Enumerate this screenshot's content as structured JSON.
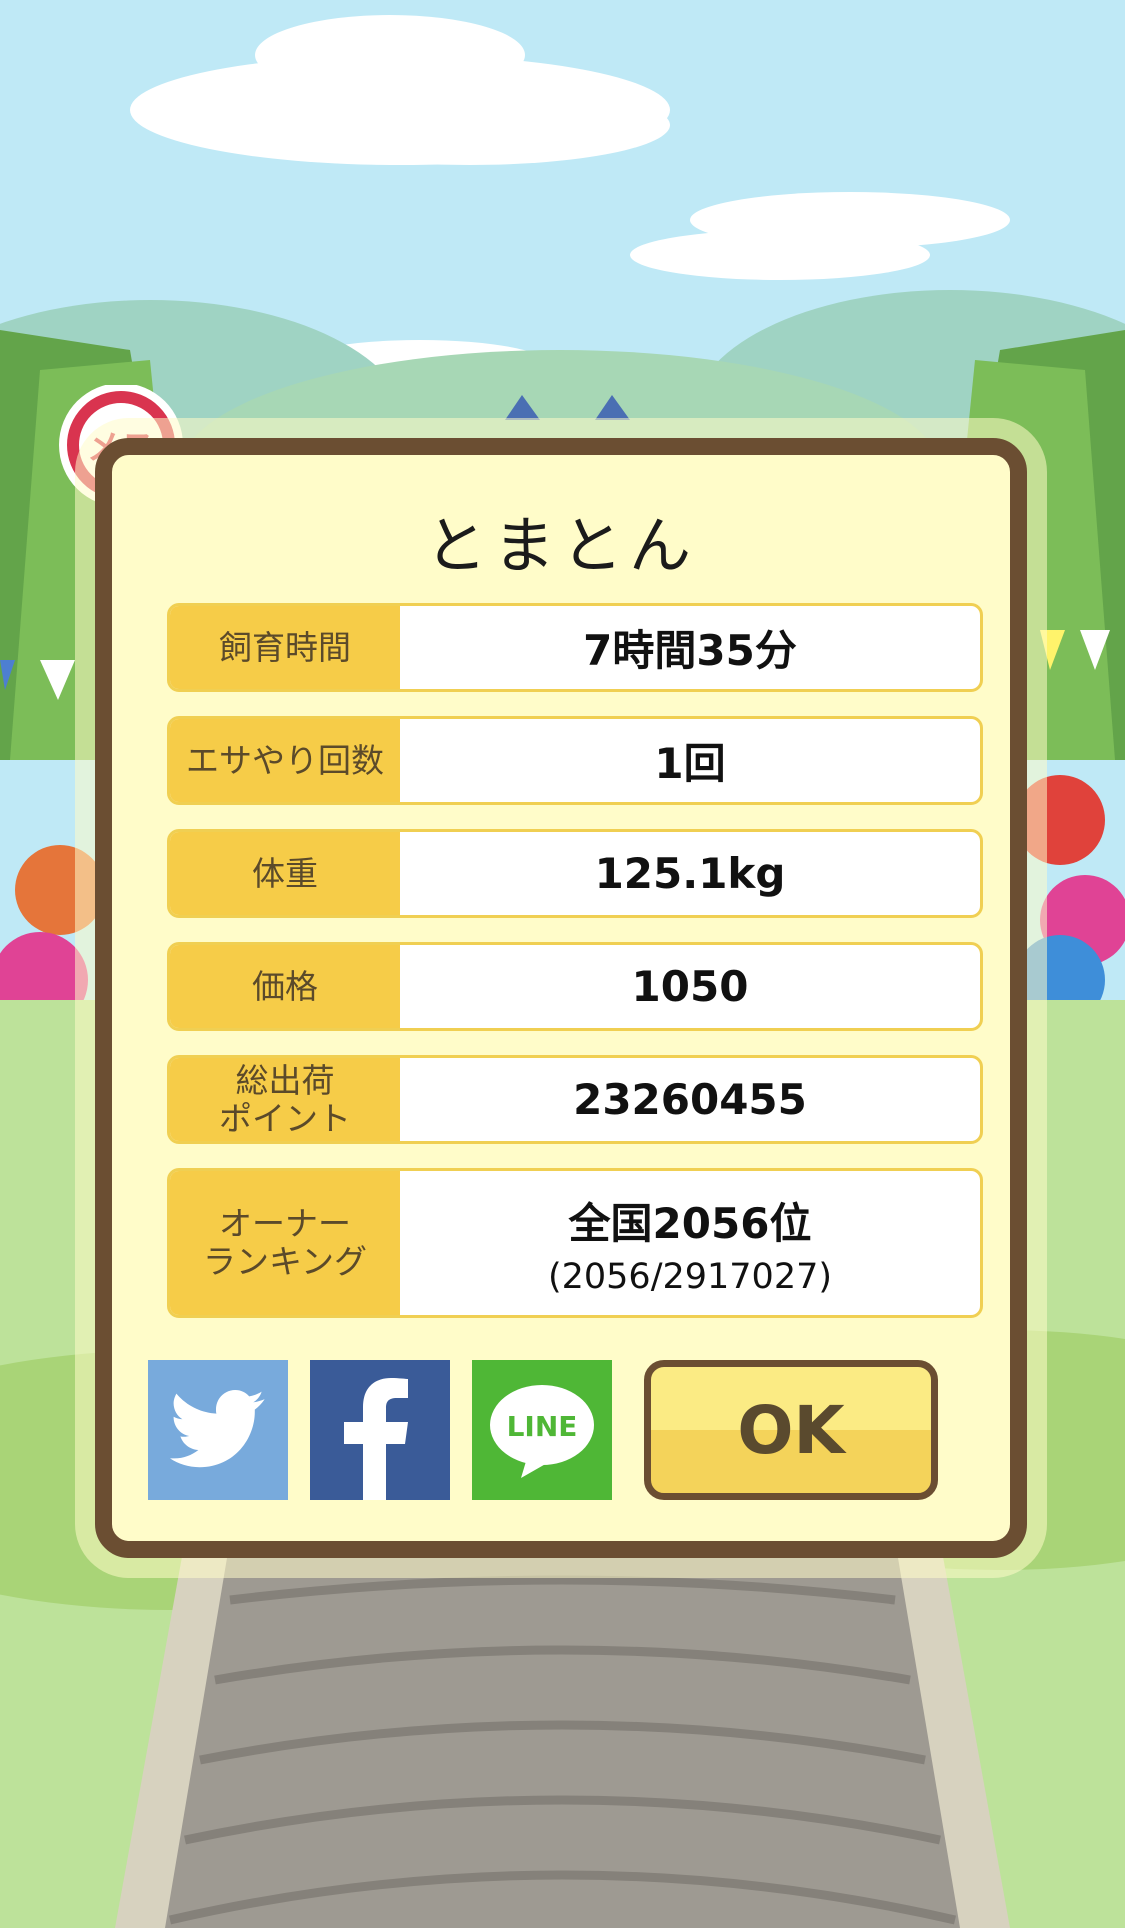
{
  "dialog": {
    "title": "とまとん",
    "rows": [
      {
        "label": "飼育時間",
        "value": "7時間35分"
      },
      {
        "label": "エサやり回数",
        "value": "1回"
      },
      {
        "label": "体重",
        "value": "125.1kg"
      },
      {
        "label": "価格",
        "value": "1050"
      },
      {
        "label": "総出荷\nポイント",
        "value": "23260455"
      },
      {
        "label": "オーナー\nランキング",
        "value": "全国2056位",
        "sub": "(2056/2917027)"
      }
    ],
    "share": {
      "twitter_icon": "twitter-bird-icon",
      "facebook_icon": "facebook-f-icon",
      "line_icon": "line-speech-bubble-icon",
      "line_text": "LINE"
    },
    "ok_label": "OK"
  },
  "badge": {
    "text": "メス",
    "icon": "female-symbol-icon"
  },
  "colors": {
    "frame": "#6b4e32",
    "panel": "#fffcc9",
    "label_bg": "#f6cc48",
    "twitter": "#78aadc",
    "facebook": "#3a5b98",
    "line": "#4fb736",
    "badge": "#d9344f"
  }
}
